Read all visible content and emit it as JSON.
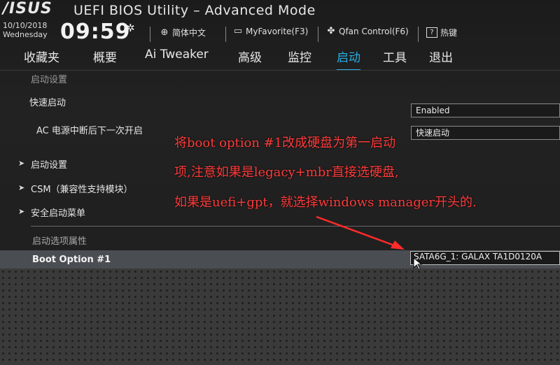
{
  "header": {
    "logo": "/ISUS",
    "title": "UEFI BIOS Utility – Advanced Mode",
    "date": "10/10/2018",
    "weekday": "Wednesday",
    "time": "09:59",
    "buttons": [
      {
        "label": "简体中文",
        "icon": "globe-icon"
      },
      {
        "label": "MyFavorite(F3)",
        "icon": "favorite-icon"
      },
      {
        "label": "Qfan Control(F6)",
        "icon": "fan-icon"
      },
      {
        "label": "热键",
        "icon": "help-icon",
        "icon_text": "?"
      }
    ]
  },
  "tabs": [
    {
      "label": "收藏夹"
    },
    {
      "label": "概要"
    },
    {
      "label": "Ai Tweaker"
    },
    {
      "label": "高级"
    },
    {
      "label": "监控"
    },
    {
      "label": "启动",
      "active": true
    },
    {
      "label": "工具"
    },
    {
      "label": "退出"
    }
  ],
  "content": {
    "breadcrumb": "启动设置",
    "fast_boot": {
      "label": "快速启动",
      "value": "Enabled"
    },
    "ac_power": {
      "label": "AC 电源中断后下一次开启",
      "value": "快速启动"
    },
    "submenus": [
      {
        "label": "启动设置"
      },
      {
        "label": "CSM（兼容性支持模块）"
      },
      {
        "label": "安全启动菜单"
      }
    ],
    "boot_priority_header": "启动选项属性",
    "boot_option_1": {
      "label": "Boot Option #1",
      "value": "SATA6G_1: GALAX TA1D0120A"
    }
  },
  "annotation": {
    "lines": [
      "将boot option #1改成硬盘为第一启动",
      "项,注意如果是legacy+mbr直接选硬盘,",
      "如果是uefi+gpt，就选择windows manager开头的."
    ],
    "color": "#ff3b3b"
  },
  "colors": {
    "accent": "#29aee3",
    "highlight": "#4a4d52"
  }
}
